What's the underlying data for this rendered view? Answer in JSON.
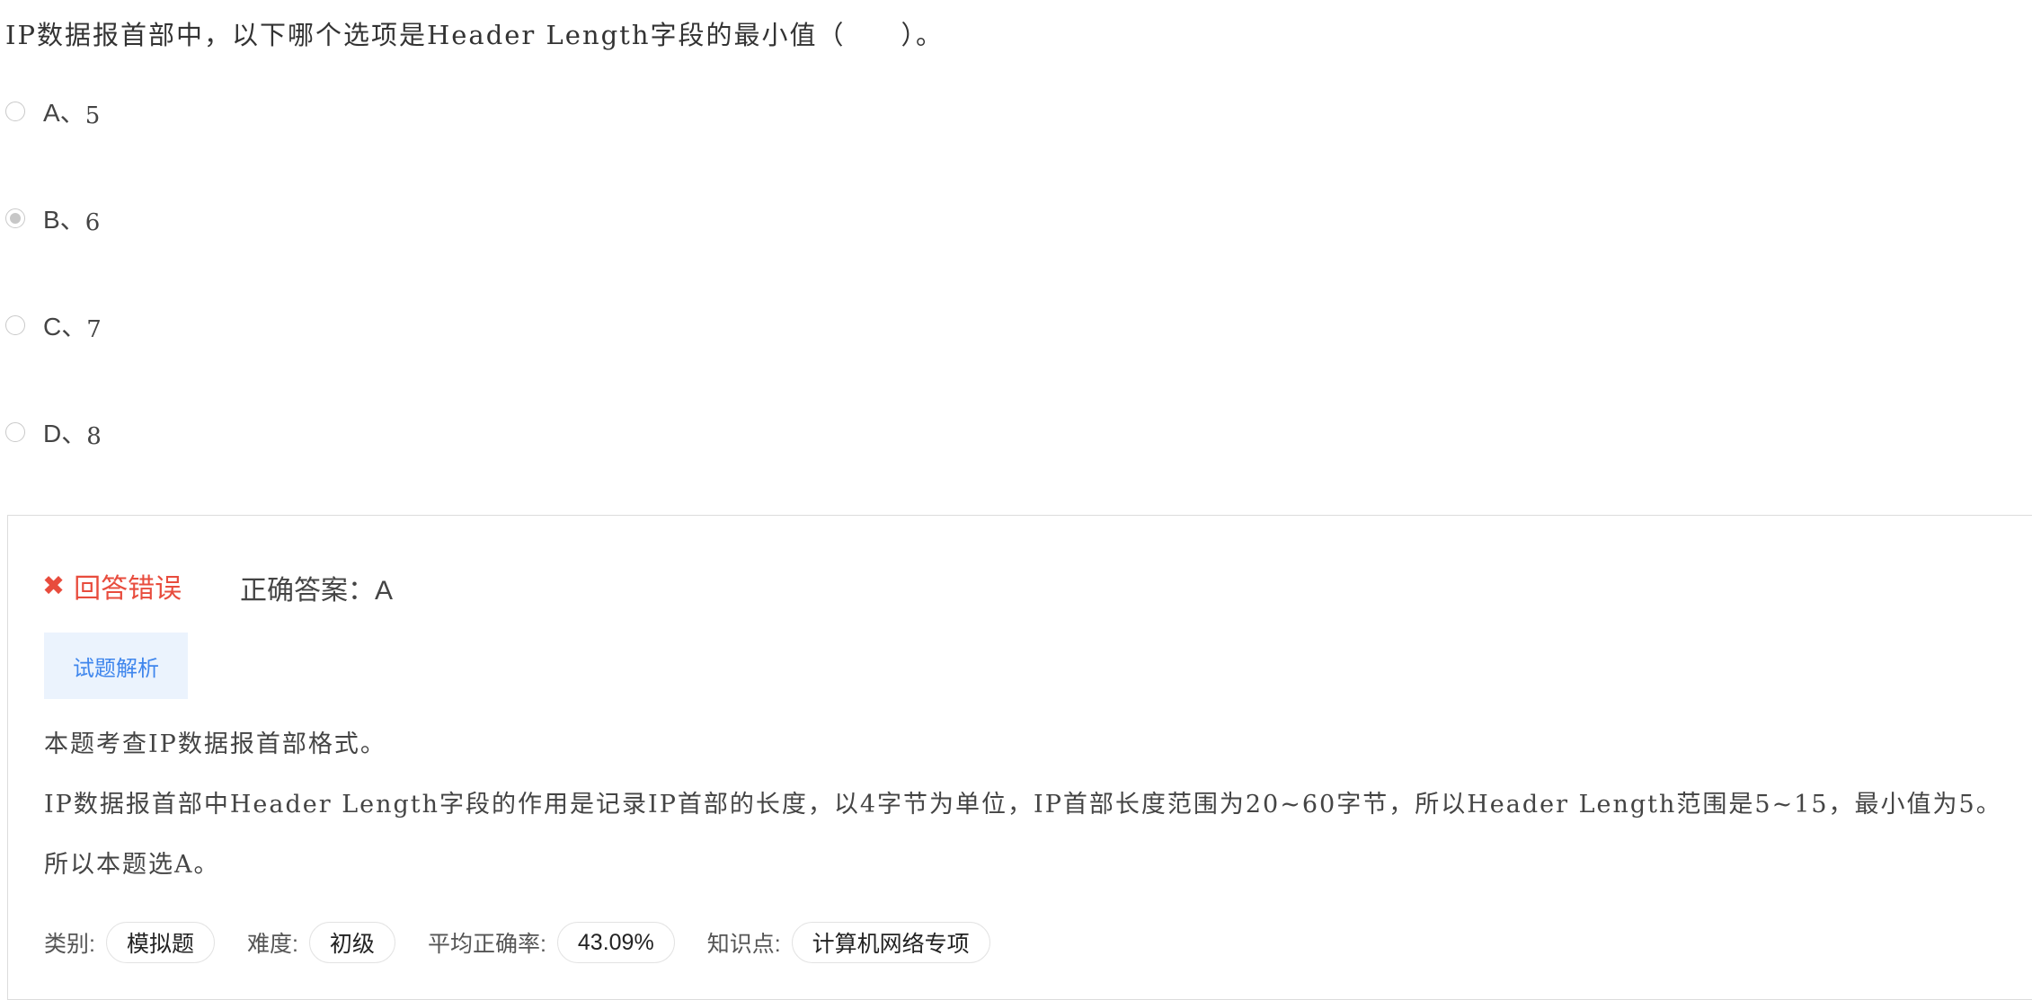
{
  "question": {
    "text": "IP数据报首部中，以下哪个选项是Header Length字段的最小值（　　）。"
  },
  "options": [
    {
      "letter": "A、",
      "value": "5",
      "selected": false
    },
    {
      "letter": "B、",
      "value": "6",
      "selected": true
    },
    {
      "letter": "C、",
      "value": "7",
      "selected": false
    },
    {
      "letter": "D、",
      "value": "8",
      "selected": false
    }
  ],
  "result": {
    "status_icon": "✖",
    "status_text": "回答错误",
    "correct_answer": "正确答案：A",
    "status_color": "#e84c3d"
  },
  "analysis": {
    "tab_label": "试题解析",
    "lines": [
      "本题考查IP数据报首部格式。",
      "IP数据报首部中Header Length字段的作用是记录IP首部的长度，以4字节为单位，IP首部长度范围为20~60字节，所以Header Length范围是5~15，最小值为5。",
      "所以本题选A。"
    ]
  },
  "meta": {
    "category_label": "类别:",
    "category_value": "模拟题",
    "difficulty_label": "难度:",
    "difficulty_value": "初级",
    "accuracy_label": "平均正确率:",
    "accuracy_value": "43.09%",
    "knowledge_label": "知识点:",
    "knowledge_value": "计算机网络专项"
  },
  "colors": {
    "accent_blue": "#3f86ed",
    "tab_bg": "#ebf3fd",
    "error_red": "#e84c3d"
  }
}
